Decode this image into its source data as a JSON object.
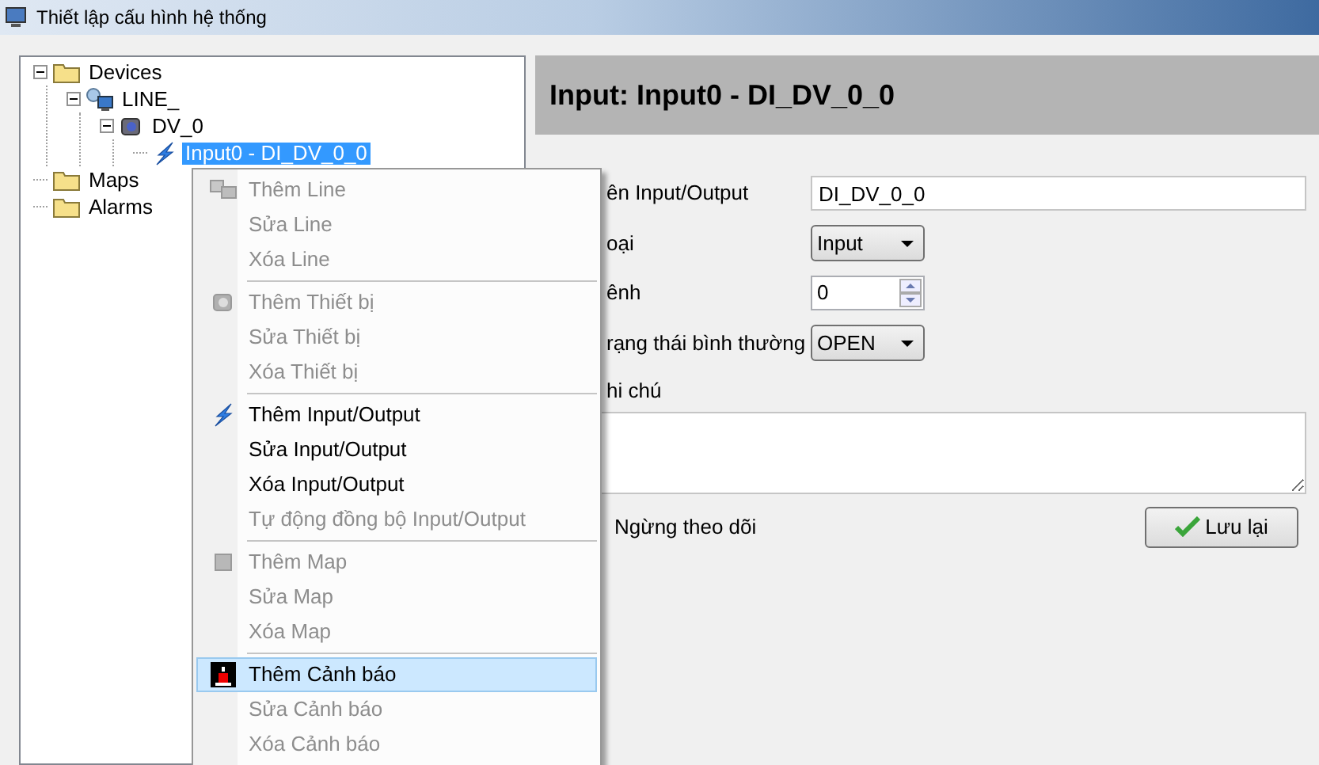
{
  "window": {
    "title": "Thiết lập cấu hình hệ thống"
  },
  "tree": [
    {
      "label": "Devices",
      "kind": "folder",
      "expanded": true,
      "selected": false,
      "children": [
        {
          "label": "LINE_",
          "kind": "network",
          "expanded": true,
          "selected": false,
          "children": [
            {
              "label": "DV_0",
              "kind": "device",
              "expanded": true,
              "selected": false,
              "children": [
                {
                  "label": "Input0 - DI_DV_0_0",
                  "kind": "io",
                  "selected": true
                }
              ]
            }
          ]
        }
      ]
    },
    {
      "label": "Maps",
      "kind": "folder",
      "selected": false
    },
    {
      "label": "Alarms",
      "kind": "folder",
      "selected": false
    }
  ],
  "detail": {
    "title": "Input: Input0 - DI_DV_0_0",
    "fields": [
      {
        "kind": "text",
        "label": "ên Input/Output",
        "value": "DI_DV_0_0"
      },
      {
        "kind": "select",
        "label": "oại",
        "value": "Input"
      },
      {
        "kind": "spin",
        "label": "ênh",
        "value": "0"
      },
      {
        "kind": "select",
        "label": "rạng thái bình thường",
        "value": "OPEN"
      },
      {
        "kind": "textarea",
        "label": "hi chú"
      }
    ],
    "monitor_label": "Ngừng theo dõi",
    "save_button": "Lưu lại"
  },
  "context_menu": [
    [
      {
        "label": "Thêm Line",
        "kind": "line",
        "enabled": false,
        "selected": false
      },
      {
        "label": "Sửa Line",
        "enabled": false,
        "selected": false
      },
      {
        "label": "Xóa Line",
        "enabled": false,
        "selected": false
      }
    ],
    [
      {
        "label": "Thêm Thiết bị",
        "kind": "device",
        "enabled": false,
        "selected": false
      },
      {
        "label": "Sửa Thiết bị",
        "enabled": false,
        "selected": false
      },
      {
        "label": "Xóa Thiết bị",
        "enabled": false,
        "selected": false
      }
    ],
    [
      {
        "label": "Thêm Input/Output",
        "kind": "io",
        "enabled": true,
        "selected": false
      },
      {
        "label": "Sửa Input/Output",
        "enabled": true,
        "selected": false
      },
      {
        "label": "Xóa Input/Output",
        "enabled": true,
        "selected": false
      },
      {
        "label": "Tự động đồng bộ Input/Output",
        "enabled": false,
        "selected": false
      }
    ],
    [
      {
        "label": "Thêm Map",
        "kind": "map",
        "enabled": false,
        "selected": false
      },
      {
        "label": "Sửa Map",
        "enabled": false,
        "selected": false
      },
      {
        "label": "Xóa Map",
        "enabled": false,
        "selected": false
      }
    ],
    [
      {
        "label": "Thêm Cảnh báo",
        "kind": "alarm",
        "enabled": true,
        "selected": true
      },
      {
        "label": "Sửa Cảnh báo",
        "enabled": false,
        "selected": false
      },
      {
        "label": "Xóa Cảnh báo",
        "enabled": false,
        "selected": false
      }
    ]
  ]
}
